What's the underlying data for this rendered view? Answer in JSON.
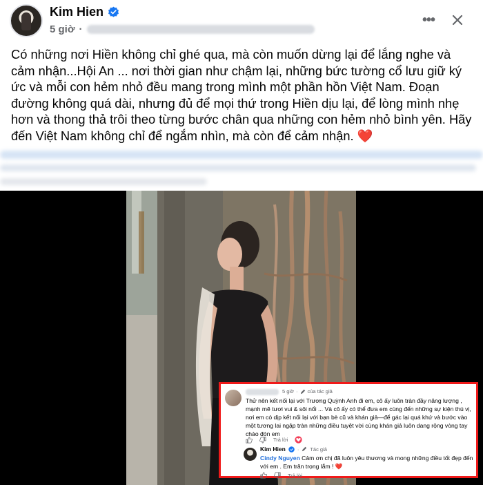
{
  "post": {
    "author": "Kim Hien",
    "time": "5 giờ",
    "separator": "·",
    "body": "Có những nơi Hiền không chỉ ghé qua, mà còn muốn dừng lại để lắng nghe và cảm nhận...Hội An ... nơi thời gian như chậm lại, những bức tường cổ lưu giữ ký ức và mỗi con hẻm nhỏ đều mang trong mình một phần hồn Việt Nam. Đoạn đường không quá dài, nhưng đủ để mọi thứ trong Hiền dịu lại, để lòng mình nhẹ hơn và thong thả trôi theo từng bước chân qua những con hẻm nhỏ bình yên. Hãy đến Việt Nam không chỉ để ngắm nhìn, mà còn để cảm nhận.",
    "heart": "❤️"
  },
  "comment": {
    "time": "5 giờ",
    "sep": "·",
    "tag": "của tác giả",
    "text": "Thử nên kết nối lại với Trương Quỳnh Anh đi em, cô ấy luôn tràn đầy năng lượng , mạnh mẽ tươi vui & sôi nổi ... Và cô ấy có thể đưa em cùng đến những sự kiện thú vị, nơi em có dịp kết nối lại với bạn bè cũ và khán giả—để gác lại quá khứ và bước vào một tương lai ngập tràn những điều tuyệt vời cùng khán giả luôn dang rộng vòng tay chào đón em",
    "reply_label": "Trả lời"
  },
  "reply": {
    "author": "Kim Hien",
    "author_tag": "Tác giả",
    "mention": "Cindy Nguyen",
    "text": " Cảm ơn chị đã luôn yêu thương và mong những điều tốt đẹp đến với em . Em trân trọng lắm !",
    "reply_label": "Trả lời"
  },
  "icons": {
    "verified": "verified-badge-icon",
    "more": "more-options-icon",
    "close": "close-icon",
    "like": "like-icon",
    "love": "love-reaction-icon",
    "edit": "pencil-icon"
  },
  "colors": {
    "facebook_blue": "#1877f2",
    "highlight_border": "#f01a1a",
    "heart": "#e41e3f",
    "mention": "#216fdb"
  }
}
